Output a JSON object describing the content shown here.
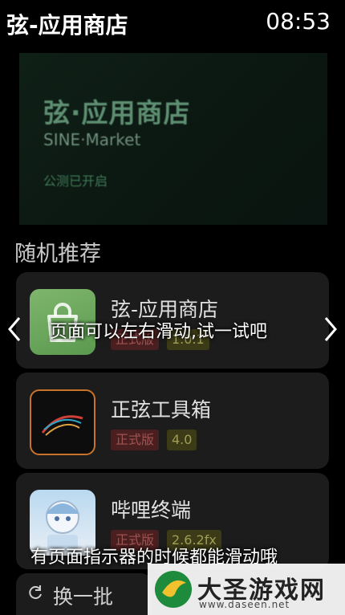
{
  "status_bar": {
    "app_title": "弦-应用商店",
    "time": "08:53"
  },
  "banner": {
    "title": "弦·应用商店",
    "subtitle": "SINE·Market",
    "note": "公测已开启"
  },
  "section": {
    "title": "随机推荐"
  },
  "apps": [
    {
      "name": "弦-应用商店",
      "type": "正式版",
      "version": "1.0.1",
      "icon": "shopping-bag-icon"
    },
    {
      "name": "正弦工具箱",
      "type": "正式版",
      "version": "4.0",
      "icon": "sine-wave-icon"
    },
    {
      "name": "哔哩终端",
      "type": "正式版",
      "version": "2.6.2fx",
      "icon": "anime-character-icon"
    }
  ],
  "refresh": {
    "label": "换一批",
    "icon": "refresh-icon"
  },
  "hints": {
    "swipe": "页面可以左右滑动,试一试吧",
    "indicator": "有页面指示器的时候都能滑动哦"
  },
  "watermark": {
    "text": "大圣游戏网",
    "url": "www.daseen.net"
  },
  "colors": {
    "background": "#000000",
    "card": "#1c1c1c",
    "badge_type": "#a05353",
    "badge_version": "#a09e54"
  }
}
